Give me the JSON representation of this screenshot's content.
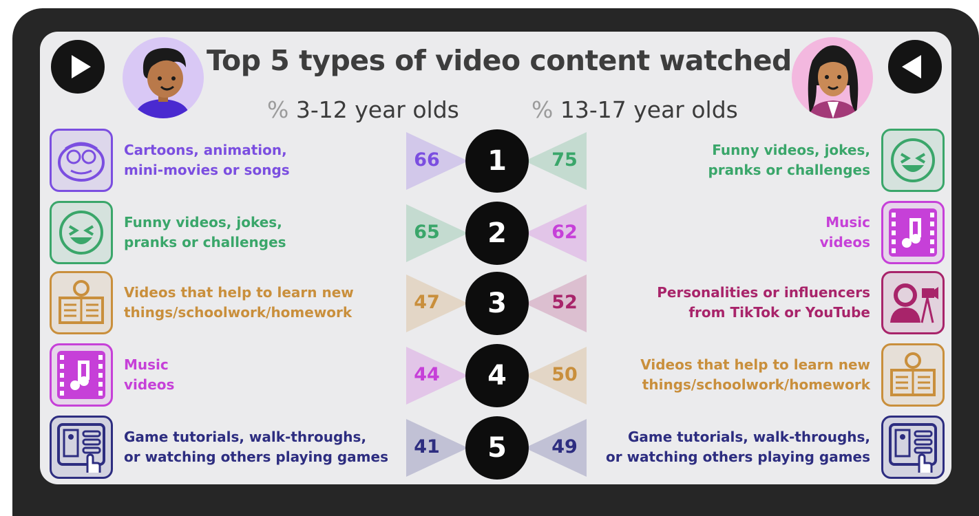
{
  "title": "Top 5 types of video content watched",
  "left_header": {
    "pct": "%",
    "text": "3-12 year olds"
  },
  "right_header": {
    "pct": "%",
    "text": "13-17 year olds"
  },
  "nav": {
    "left": "play-icon",
    "right": "back-icon"
  },
  "colors": {
    "cartoons": "#7b4ee0",
    "funny": "#3aa66a",
    "learn": "#c98f3c",
    "music": "#c640d8",
    "games": "#2d2d80",
    "influencers": "#a8246a"
  },
  "chart_data": {
    "type": "table",
    "title": "Top 5 types of video content watched",
    "unit": "%",
    "groups": [
      "3-12 year olds",
      "13-17 year olds"
    ],
    "ranks": [
      "1",
      "2",
      "3",
      "4",
      "5"
    ],
    "left": [
      {
        "label_lines": [
          "Cartoons, animation,",
          "mini-movies or songs"
        ],
        "value": 66,
        "color": "#7b4ee0",
        "icon": "cartoon-face-icon"
      },
      {
        "label_lines": [
          "Funny videos, jokes,",
          "pranks or challenges"
        ],
        "value": 65,
        "color": "#3aa66a",
        "icon": "laughing-face-icon"
      },
      {
        "label_lines": [
          "Videos that help to learn new",
          "things/schoolwork/homework"
        ],
        "value": 47,
        "color": "#c98f3c",
        "icon": "lightbulb-book-icon"
      },
      {
        "label_lines": [
          "Music",
          "videos"
        ],
        "value": 44,
        "color": "#c640d8",
        "icon": "music-film-icon"
      },
      {
        "label_lines": [
          "Game tutorials, walk-throughs,",
          "or watching others playing games"
        ],
        "value": 41,
        "color": "#2d2d80",
        "icon": "game-controller-icon"
      }
    ],
    "right": [
      {
        "label_lines": [
          "Funny videos, jokes,",
          "pranks or challenges"
        ],
        "value": 75,
        "color": "#3aa66a",
        "icon": "laughing-face-icon"
      },
      {
        "label_lines": [
          "Music",
          "videos"
        ],
        "value": 62,
        "color": "#c640d8",
        "icon": "music-film-icon"
      },
      {
        "label_lines": [
          "Personalities or influencers",
          "from TikTok or YouTube"
        ],
        "value": 52,
        "color": "#a8246a",
        "icon": "influencer-camera-icon"
      },
      {
        "label_lines": [
          "Videos that help to learn new",
          "things/schoolwork/homework"
        ],
        "value": 50,
        "color": "#c98f3c",
        "icon": "lightbulb-book-icon"
      },
      {
        "label_lines": [
          "Game tutorials, walk-throughs,",
          "or watching others playing games"
        ],
        "value": 49,
        "color": "#2d2d80",
        "icon": "game-controller-icon"
      }
    ]
  }
}
